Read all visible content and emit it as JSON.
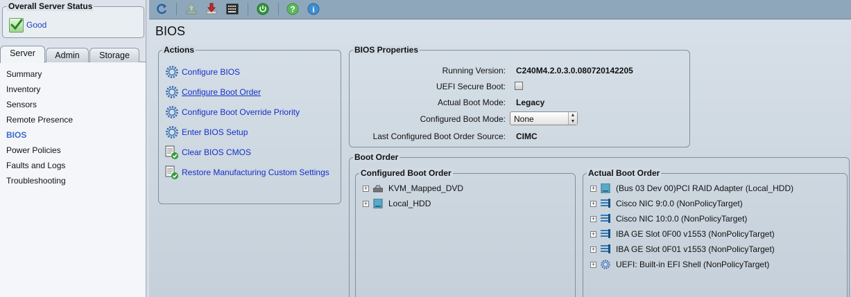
{
  "status": {
    "title": "Overall Server Status",
    "value": "Good",
    "icon": "green-check-icon"
  },
  "tabs": [
    {
      "label": "Server"
    },
    {
      "label": "Admin"
    },
    {
      "label": "Storage"
    }
  ],
  "nav": [
    {
      "label": "Summary"
    },
    {
      "label": "Inventory"
    },
    {
      "label": "Sensors"
    },
    {
      "label": "Remote Presence"
    },
    {
      "label": "BIOS"
    },
    {
      "label": "Power Policies"
    },
    {
      "label": "Faults and Logs"
    },
    {
      "label": "Troubleshooting"
    }
  ],
  "toolbar": [
    "refresh-icon",
    "upload-icon",
    "download-icon",
    "keyboard-icon",
    "power-icon",
    "help-icon",
    "info-icon"
  ],
  "page_title": "BIOS",
  "actions": {
    "title": "Actions",
    "items": [
      {
        "label": "Configure BIOS"
      },
      {
        "label": "Configure Boot Order"
      },
      {
        "label": "Configure Boot Override Priority"
      },
      {
        "label": "Enter BIOS Setup"
      },
      {
        "label": "Clear BIOS CMOS"
      },
      {
        "label": "Restore Manufacturing Custom Settings"
      }
    ]
  },
  "bios_properties": {
    "title": "BIOS Properties",
    "running_version_label": "Running Version:",
    "running_version": "C240M4.2.0.3.0.080720142205",
    "uefi_secure_boot_label": "UEFI Secure Boot:",
    "uefi_secure_boot": false,
    "actual_boot_mode_label": "Actual Boot Mode:",
    "actual_boot_mode": "Legacy",
    "configured_boot_mode_label": "Configured Boot Mode:",
    "configured_boot_mode": "None",
    "last_source_label": "Last Configured Boot Order Source:",
    "last_source": "CIMC"
  },
  "boot_order": {
    "title": "Boot Order",
    "configured": {
      "title": "Configured Boot Order",
      "items": [
        {
          "label": "KVM_Mapped_DVD",
          "icon": "dvd-drive-icon"
        },
        {
          "label": "Local_HDD",
          "icon": "hdd-icon"
        }
      ]
    },
    "actual": {
      "title": "Actual Boot Order",
      "items": [
        {
          "label": "(Bus 03 Dev 00)PCI RAID Adapter (Local_HDD)",
          "icon": "hdd-icon"
        },
        {
          "label": "Cisco NIC 9:0.0 (NonPolicyTarget)",
          "icon": "nic-icon"
        },
        {
          "label": "Cisco NIC 10:0.0 (NonPolicyTarget)",
          "icon": "nic-icon"
        },
        {
          "label": "IBA GE Slot 0F00 v1553 (NonPolicyTarget)",
          "icon": "nic-icon"
        },
        {
          "label": "IBA GE Slot 0F01 v1553 (NonPolicyTarget)",
          "icon": "nic-icon"
        },
        {
          "label": "UEFI: Built-in EFI Shell  (NonPolicyTarget)",
          "icon": "gear-icon"
        }
      ]
    }
  },
  "colors": {
    "link": "#1330c8",
    "nav_active": "#3d6ac9",
    "toolbar": "#8ea7bb"
  }
}
